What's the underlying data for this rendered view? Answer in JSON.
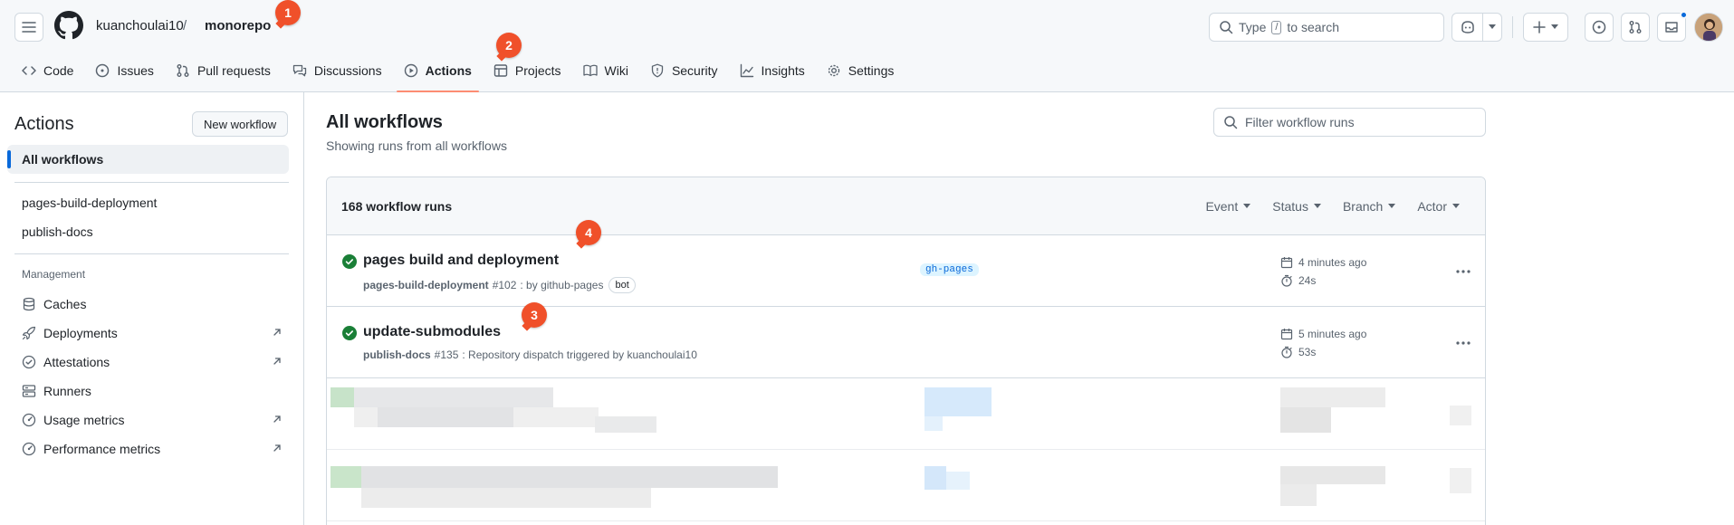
{
  "header": {
    "owner": "kuanchoulai10",
    "separator": "/",
    "repo": "monorepo",
    "search_type": "Type",
    "search_kbd": "/",
    "search_rest": "to search"
  },
  "tabs": [
    {
      "label": "Code"
    },
    {
      "label": "Issues"
    },
    {
      "label": "Pull requests"
    },
    {
      "label": "Discussions"
    },
    {
      "label": "Actions",
      "active": true
    },
    {
      "label": "Projects"
    },
    {
      "label": "Wiki"
    },
    {
      "label": "Security"
    },
    {
      "label": "Insights"
    },
    {
      "label": "Settings"
    }
  ],
  "sidebar": {
    "title": "Actions",
    "new_workflow": "New workflow",
    "all_workflows": "All workflows",
    "workflows": [
      "pages-build-deployment",
      "publish-docs"
    ],
    "management_label": "Management",
    "management": [
      {
        "label": "Caches",
        "icon": "database-icon",
        "external": false
      },
      {
        "label": "Deployments",
        "icon": "rocket-icon",
        "external": true
      },
      {
        "label": "Attestations",
        "icon": "verified-icon",
        "external": true
      },
      {
        "label": "Runners",
        "icon": "server-icon",
        "external": false
      },
      {
        "label": "Usage metrics",
        "icon": "meter-icon",
        "external": true
      },
      {
        "label": "Performance metrics",
        "icon": "meter-icon",
        "external": true
      }
    ]
  },
  "main": {
    "title": "All workflows",
    "subtitle": "Showing runs from all workflows",
    "filter_placeholder": "Filter workflow runs",
    "runs_count": "168 workflow runs",
    "filters": [
      "Event",
      "Status",
      "Branch",
      "Actor"
    ],
    "runs": [
      {
        "title": "pages build and deployment",
        "workflow": "pages-build-deployment",
        "run_number": "#102",
        "trigger": ": by github-pages",
        "badge": "bot",
        "branch": "gh-pages",
        "when": "4 minutes ago",
        "duration": "24s",
        "status": "success"
      },
      {
        "title": "update-submodules",
        "workflow": "publish-docs",
        "run_number": "#135",
        "trigger": ": Repository dispatch triggered by kuanchoulai10",
        "badge": "",
        "branch": "",
        "when": "5 minutes ago",
        "duration": "53s",
        "status": "success"
      }
    ]
  },
  "markers": [
    "1",
    "2",
    "3",
    "4"
  ],
  "colors": {
    "accent": "#0969da",
    "success": "#1a7f37",
    "active_tab_underline": "#fd8c73",
    "marker": "#f0502a"
  }
}
